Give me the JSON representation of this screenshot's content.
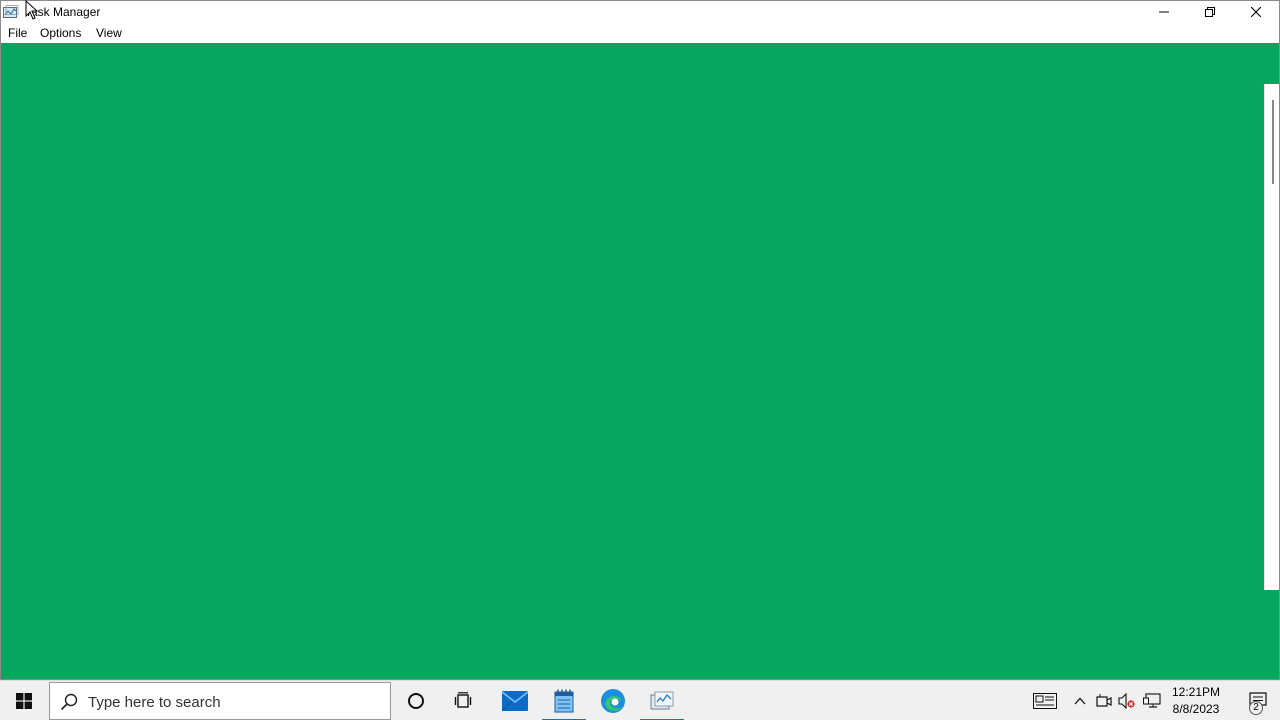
{
  "window": {
    "title": "Task Manager",
    "icon": "task-manager-icon"
  },
  "menu": {
    "file": "File",
    "options": "Options",
    "view": "View"
  },
  "content": {
    "background_color": "#04a75d"
  },
  "taskbar": {
    "search_placeholder": "Type here to search",
    "apps": [
      "cortana-icon",
      "task-view-icon",
      "mail-icon",
      "notepad-icon",
      "edge-icon",
      "task-manager-icon"
    ],
    "clock": {
      "time": "12:21PM",
      "date": "8/8/2023"
    },
    "notification_count": "2"
  }
}
